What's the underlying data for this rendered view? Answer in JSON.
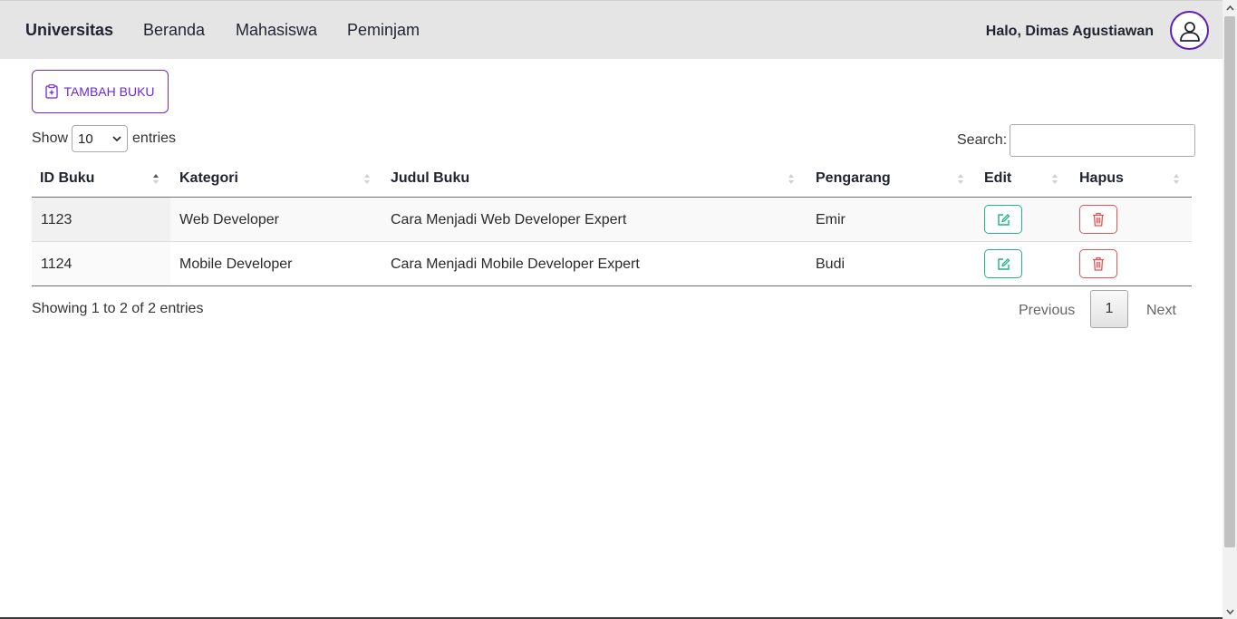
{
  "navbar": {
    "brand": "Universitas",
    "links": [
      "Beranda",
      "Mahasiswa",
      "Peminjam"
    ],
    "greeting": "Halo, Dimas Agustiawan"
  },
  "toolbar": {
    "add_label": "TAMBAH BUKU"
  },
  "length": {
    "show": "Show",
    "selected": "10",
    "entries": "entries"
  },
  "search": {
    "label": "Search:",
    "value": ""
  },
  "table": {
    "columns": [
      "ID Buku",
      "Kategori",
      "Judul Buku",
      "Pengarang",
      "Edit",
      "Hapus"
    ],
    "rows": [
      {
        "id": "1123",
        "kategori": "Web Developer",
        "judul": "Cara Menjadi Web Developer Expert",
        "pengarang": "Emir"
      },
      {
        "id": "1124",
        "kategori": "Mobile Developer",
        "judul": "Cara Menjadi Mobile Developer Expert",
        "pengarang": "Budi"
      }
    ]
  },
  "footer": {
    "info": "Showing 1 to 2 of 2 entries",
    "previous": "Previous",
    "page": "1",
    "next": "Next"
  },
  "colors": {
    "accent": "#6d28d9",
    "edit": "#20b486",
    "delete": "#e05555",
    "navbar_bg": "#e5e5e5"
  },
  "icons": {
    "add": "clipboard-plus-icon",
    "edit": "pencil-square-icon",
    "delete": "trash-icon",
    "avatar": "person-circle-icon"
  }
}
